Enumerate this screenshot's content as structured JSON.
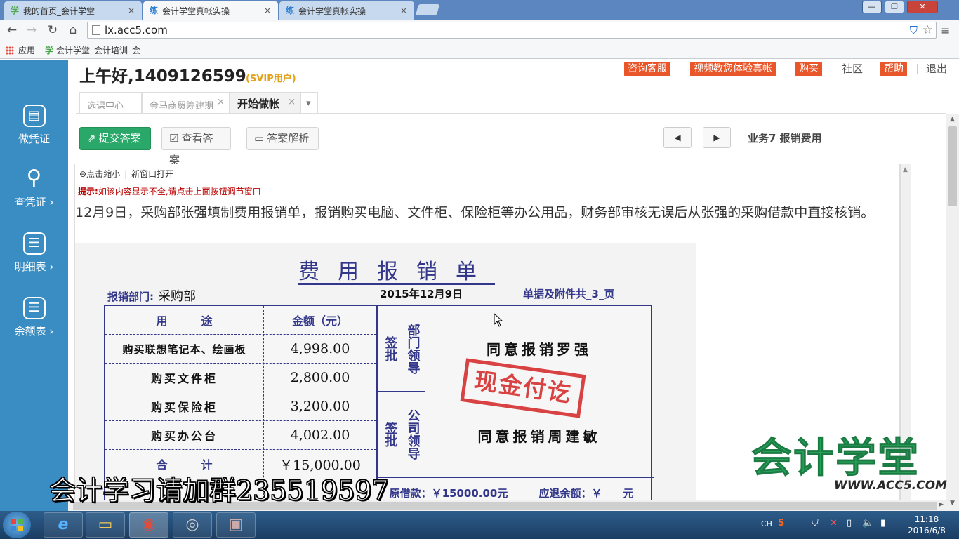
{
  "browser": {
    "tabs": [
      {
        "icon": "学",
        "title": "我的首页_会计学堂",
        "close": "×"
      },
      {
        "icon": "练",
        "title": "会计学堂真帐实操",
        "close": "×"
      },
      {
        "icon": "练",
        "title": "会计学堂真帐实操",
        "close": "×"
      }
    ],
    "window_buttons": {
      "minimize": "—",
      "maximize": "❐",
      "close": "✕"
    },
    "nav": {
      "back": "←",
      "forward": "→",
      "reload": "↻",
      "home": "⌂"
    },
    "url": "lx.acc5.com",
    "bookmarks": {
      "apps_label": "应用",
      "link_icon": "学",
      "link_label": "会计学堂_会计培训_会"
    }
  },
  "sidebar": {
    "items": [
      {
        "icon": "▤",
        "label": "做凭证"
      },
      {
        "icon": "⚲",
        "label": "查凭证 ›"
      },
      {
        "icon": "☰",
        "label": "明细表 ›"
      },
      {
        "icon": "☰",
        "label": "余额表 ›"
      }
    ]
  },
  "header": {
    "greeting": "上午好,1409126599",
    "svip": "(SVIP用户)",
    "links": {
      "consult": "咨询客服",
      "video": "视频教您体验真帐",
      "buy": "购买",
      "community": "社区",
      "help": "帮助",
      "logout": "退出"
    }
  },
  "tabs": [
    {
      "label": "选课中心"
    },
    {
      "label": "金马商贸筹建期",
      "close": "×"
    },
    {
      "label": "开始做帐",
      "close": "×"
    }
  ],
  "tabs_dropdown": "▾",
  "actions": {
    "submit": "提交答案",
    "view": "查看答案",
    "analysis": "答案解析",
    "prev": "◀",
    "next": "▶",
    "business_title": "业务7 报销费用"
  },
  "frame": {
    "zoom_out": "点击缩小",
    "new_window": "新窗口打开",
    "tip_label": "提示:",
    "tip_text": "如该内容显示不全,请点击上面按钮调节窗口",
    "question": "12月9日，采购部张强填制费用报销单，报销购买电脑、文件柜、保险柜等办公用品，财务部审核无误后从张强的采购借款中直接核销。"
  },
  "voucher": {
    "title": "费用报销单",
    "dept_label": "报销部门:",
    "dept_value": "采购部",
    "date": "2015年12月9日",
    "attach": "单据及附件共_3_页",
    "col_purpose": "用　　　途",
    "col_amount": "金额（元）",
    "rows": [
      {
        "purpose": "购买联想笔记本、绘画板",
        "amount": "4,998.00"
      },
      {
        "purpose": "购买文件柜",
        "amount": "2,800.00"
      },
      {
        "purpose": "购买保险柜",
        "amount": "3,200.00"
      },
      {
        "purpose": "购买办公台",
        "amount": "4,002.00"
      }
    ],
    "total_label": "合　　　计",
    "total_amount": "￥15,000.00",
    "sign_label": "签批",
    "dept_leader": "部门领导",
    "company_leader": "公司领导",
    "dept_opinion": "同意报销罗强",
    "company_opinion": "同意报销周建敏",
    "stamp": "现金付讫",
    "loan": "原借款：￥15000.00元",
    "refund": "应退余额：￥　　元"
  },
  "overlay": {
    "caption": "会计学习请加群235519597",
    "watermark_main": "会计学堂",
    "watermark_sub": "WWW.ACC5.COM"
  },
  "taskbar": {
    "apps": [
      {
        "icon": "e"
      },
      {
        "icon": "▭"
      },
      {
        "icon": "◉"
      },
      {
        "icon": "◎"
      },
      {
        "icon": "▣"
      }
    ],
    "tray": {
      "lang": "CH",
      "icons": [
        "S",
        "⛉",
        "✕",
        "▯",
        "🔈",
        "▮"
      ]
    },
    "time": "11:18",
    "date": "2016/6/8"
  },
  "colors": {
    "sidebar": "#3a8dc2",
    "accent_orange": "#e8562a",
    "submit_green": "#29a86a",
    "voucher_blue": "#33378a",
    "stamp_red": "#d42a2a"
  }
}
